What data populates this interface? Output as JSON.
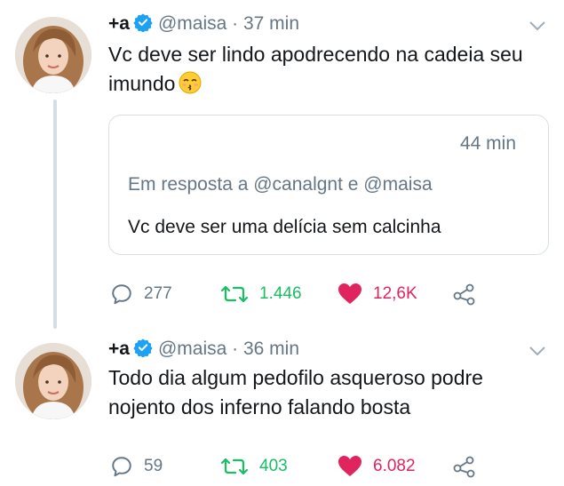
{
  "tweets": [
    {
      "display_name": "+a",
      "handle": "@maisa",
      "separator": "·",
      "time": "37 min",
      "text": "Vc deve ser lindo apodrecendo na cadeia seu imundo",
      "emoji": "kissing-face-closed-eyes",
      "quoted": {
        "time": "44 min",
        "reply_to": "Em resposta a @canalgnt e @maisa",
        "text": "Vc deve ser uma delícia sem calcinha"
      },
      "replies": "277",
      "retweets": "1.446",
      "likes": "12,6K"
    },
    {
      "display_name": "+a",
      "handle": "@maisa",
      "separator": "·",
      "time": "36 min",
      "text": "Todo dia algum pedofilo asqueroso podre nojento dos inferno falando bosta",
      "replies": "59",
      "retweets": "403",
      "likes": "6.082"
    }
  ],
  "colors": {
    "verified": "#1da1f2",
    "retweet": "#17bf63",
    "like": "#e0245e",
    "muted": "#657786"
  }
}
